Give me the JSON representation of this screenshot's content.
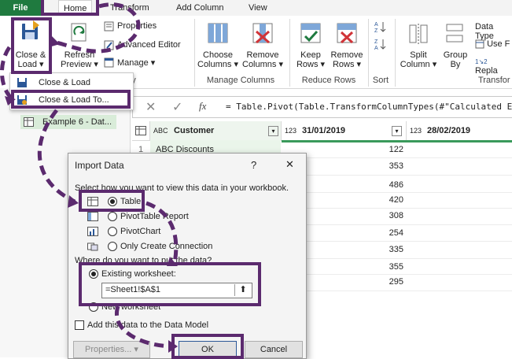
{
  "tabs": [
    "File",
    "Home",
    "Transform",
    "Add Column",
    "View"
  ],
  "ribbon": {
    "close_load_line1": "Close &",
    "close_load_line2": "Load ▾",
    "refresh_line1": "Refresh",
    "refresh_line2": "Preview ▾",
    "properties": "Properties",
    "advanced_editor": "Advanced Editor",
    "manage": "Manage ▾",
    "query_group": "y",
    "choose_columns_1": "Choose",
    "choose_columns_2": "Columns ▾",
    "remove_columns_1": "Remove",
    "remove_columns_2": "Columns ▾",
    "manage_columns_group": "Manage Columns",
    "keep_rows_1": "Keep",
    "keep_rows_2": "Rows ▾",
    "remove_rows_1": "Remove",
    "remove_rows_2": "Rows ▾",
    "reduce_rows_group": "Reduce Rows",
    "sort_group": "Sort",
    "split_column_1": "Split",
    "split_column_2": "Column ▾",
    "group_by_1": "Group",
    "group_by_2": "By",
    "data_type": "Data Type",
    "use_first_row": "Use F",
    "replace": "Repla",
    "transform_group": "Transfor"
  },
  "menu": {
    "close_load": "Close & Load",
    "close_load_to": "Close & Load To..."
  },
  "leftpane": {
    "query_name": "Example 6 - Dat..."
  },
  "formula": {
    "fx": "fx",
    "text": "= Table.Pivot(Table.TransformColumnTypes(#\"Calculated E"
  },
  "grid": {
    "col1_type": "ABC",
    "col1_header": "Customer",
    "col2_type": "123",
    "col2_header": "31/01/2019",
    "col3_type": "123",
    "col3_header": "28/02/2019",
    "row_num_1": "1",
    "row1_customer": "ABC Discounts",
    "values": [
      "122",
      "353",
      "486",
      "420",
      "308",
      "254",
      "335",
      "355",
      "295"
    ]
  },
  "dialog": {
    "title": "Import Data",
    "help": "?",
    "close": "✕",
    "select_prompt": "Select how you want to view this data in your workbook.",
    "opt_table": "Table",
    "opt_pivot_table": "PivotTable Report",
    "opt_pivot_chart": "PivotChart",
    "opt_connection": "Only Create Connection",
    "where_prompt": "Where do you want to put the data?",
    "opt_existing": "Existing worksheet:",
    "range_value": "=Sheet1!$A$1",
    "opt_new": "New worksheet",
    "add_data_model": "Add this data to the Data Model",
    "properties_btn": "Properties... ▾",
    "ok_btn": "OK",
    "cancel_btn": "Cancel"
  },
  "colors": {
    "file_tab": "#1f7a3f",
    "highlight": "#5b2a6e",
    "query_selected": "#d9ecd9"
  }
}
